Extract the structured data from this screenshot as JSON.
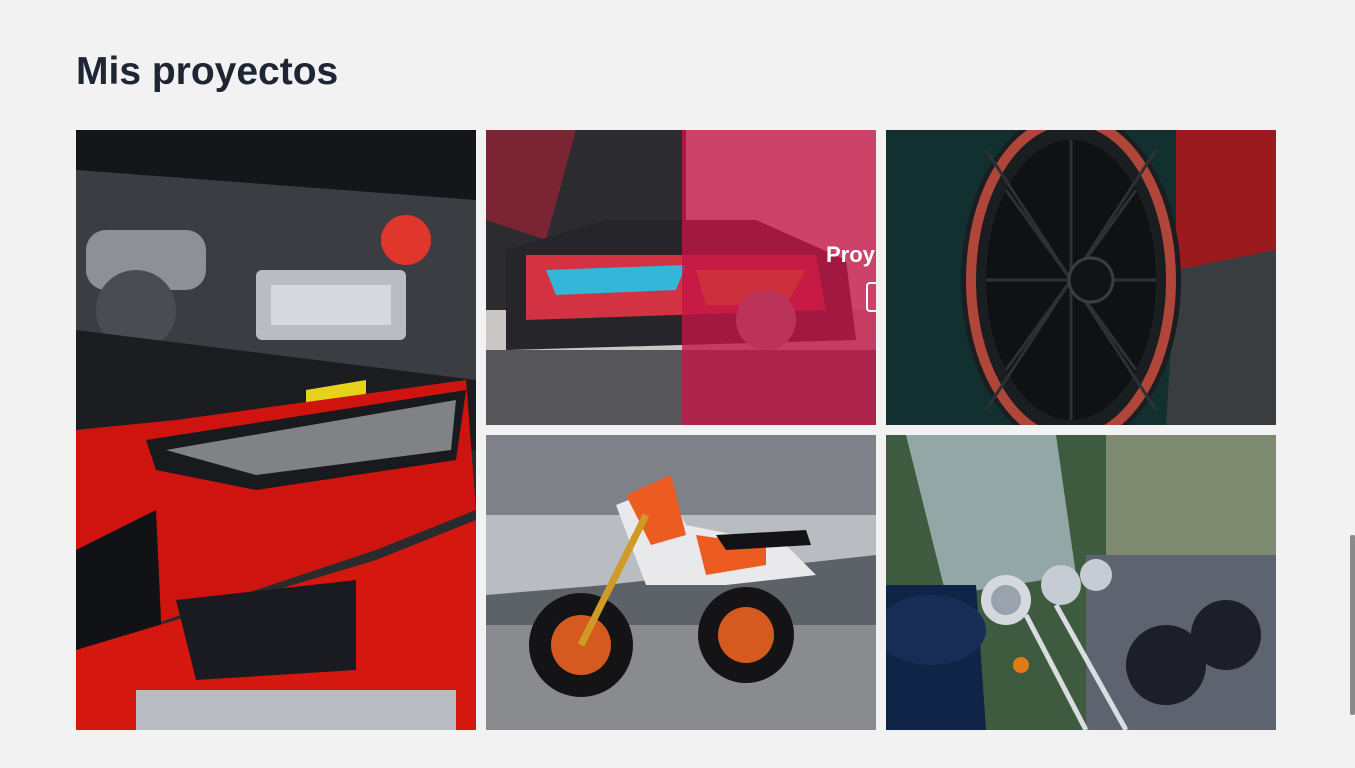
{
  "section": {
    "title": "Mis proyectos"
  },
  "projects": [
    {
      "subject": "red-audi-engine-bay-photo"
    },
    {
      "subject": "wrapped-volkswagen-showroom-photo",
      "hover_overlay": {
        "title": "Proy",
        "icon": "document-icon",
        "color": "#c41446"
      }
    },
    {
      "subject": "bbs-wheel-red-car-photo"
    },
    {
      "subject": "orange-supermoto-bike-photo"
    },
    {
      "subject": "harley-davidson-motorcycles-photo"
    }
  ],
  "colors": {
    "background": "#f2f2f2",
    "title": "#1e2533",
    "overlay": "#c41446"
  }
}
